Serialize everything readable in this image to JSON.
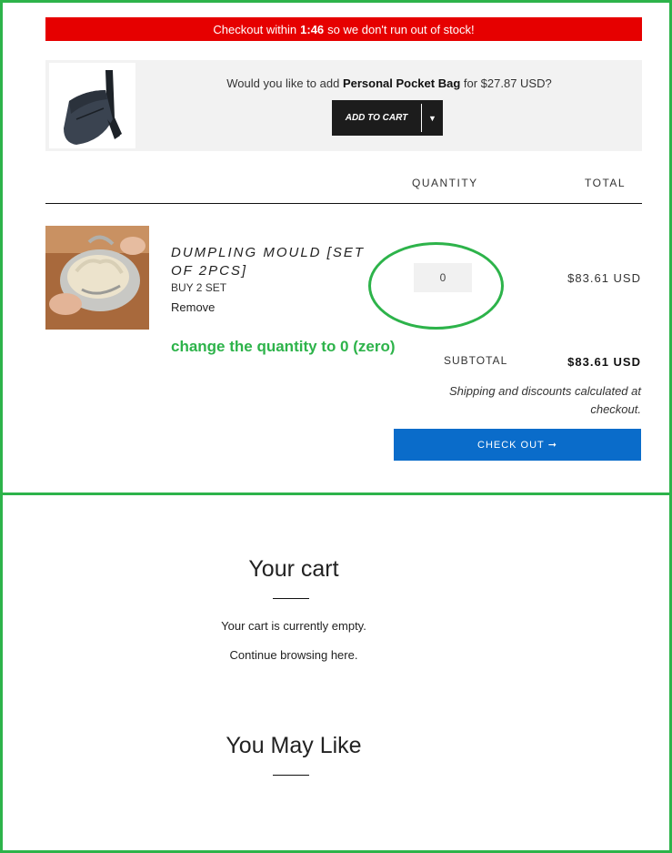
{
  "urgency": {
    "prefix": "Checkout within",
    "timer": "1:46",
    "suffix": "so we don't run out of stock!"
  },
  "upsell": {
    "prefix": "Would you like to add",
    "product_name": "Personal Pocket Bag",
    "suffix": "for $27.87 USD?",
    "add_to_cart_label": "ADD TO CART",
    "image_icon": "crossbody-bag-photo"
  },
  "table_headers": {
    "quantity": "QUANTITY",
    "total": "TOTAL"
  },
  "line_item": {
    "title": "DUMPLING MOULD [SET OF 2PCS]",
    "variant": "BUY 2 SET",
    "remove_label": "Remove",
    "quantity": "0",
    "total": "$83.61 USD",
    "image_icon": "dumpling-mould-photo"
  },
  "annotation": {
    "text": "change the quantity to 0 (zero)",
    "color": "#2db34a"
  },
  "summary": {
    "subtotal_label": "SUBTOTAL",
    "subtotal_value": "$83.61 USD",
    "shipping_note": "Shipping and discounts calculated at checkout.",
    "checkout_label": "CHECK OUT",
    "checkout_arrow": "➞"
  },
  "empty_cart": {
    "title": "Your cart",
    "message": "Your cart is currently empty.",
    "continue_label": "Continue browsing here.",
    "you_may_like": "You May Like"
  },
  "colors": {
    "urgency_bar": "#e60000",
    "checkout_button": "#0a6cca",
    "frame_border": "#2db34a"
  }
}
